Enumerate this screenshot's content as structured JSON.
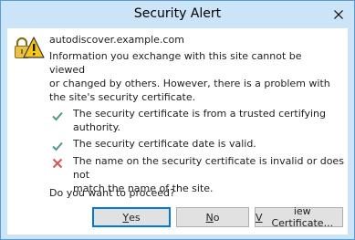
{
  "window": {
    "title": "Security Alert"
  },
  "titlebar": {
    "close_icon": "close-icon"
  },
  "dialog": {
    "icon": "warning-lock-icon",
    "host": "autodiscover.example.com",
    "info_lines": [
      "Information you exchange with this site cannot be viewed",
      "or changed by others. However, there is a problem with",
      "the site's security certificate."
    ],
    "checks": [
      {
        "status": "ok",
        "icon": "checkmark-icon",
        "lines": [
          "The security certificate is from a trusted certifying",
          "authority."
        ]
      },
      {
        "status": "ok",
        "icon": "checkmark-icon",
        "lines": [
          "The security certificate date is valid."
        ]
      },
      {
        "status": "error",
        "icon": "x-icon",
        "lines": [
          "The name on the security certificate is invalid or does not",
          "match the name of the site."
        ]
      }
    ],
    "question": "Do you want to proceed?"
  },
  "buttons": {
    "yes": {
      "u": "Y",
      "rest": "es"
    },
    "no": {
      "u": "N",
      "rest": "o"
    },
    "view": {
      "u": "V",
      "rest": "iew Certificate..."
    }
  },
  "colors": {
    "frame": "#cce4f7",
    "ok": "#4e9a8a",
    "error": "#d9534f",
    "accent": "#0078d7"
  }
}
